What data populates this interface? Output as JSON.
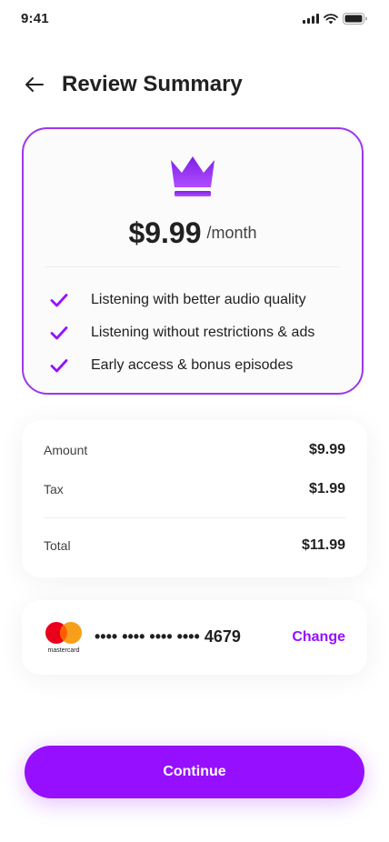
{
  "status_bar": {
    "time": "9:41",
    "icons": [
      "signal-icon",
      "wifi-icon",
      "battery-icon"
    ]
  },
  "header": {
    "back_icon": "arrow-left-icon",
    "title": "Review Summary"
  },
  "plan": {
    "icon": "crown-icon",
    "price": "$9.99",
    "period": "/month",
    "features": [
      "Listening with better audio quality",
      "Listening without restrictions & ads",
      "Early access & bonus episodes"
    ]
  },
  "summary": {
    "amount_label": "Amount",
    "amount_value": "$9.99",
    "tax_label": "Tax",
    "tax_value": "$1.99",
    "total_label": "Total",
    "total_value": "$11.99"
  },
  "payment": {
    "brand": "mastercard",
    "masked_number": "•••• •••• •••• •••• 4679",
    "change_label": "Change"
  },
  "actions": {
    "continue_label": "Continue"
  },
  "colors": {
    "primary": "#9610ff",
    "card_border": "#9e37ea",
    "text": "#212121",
    "mastercard_red": "#eb001b",
    "mastercard_orange": "#f79e1b"
  }
}
